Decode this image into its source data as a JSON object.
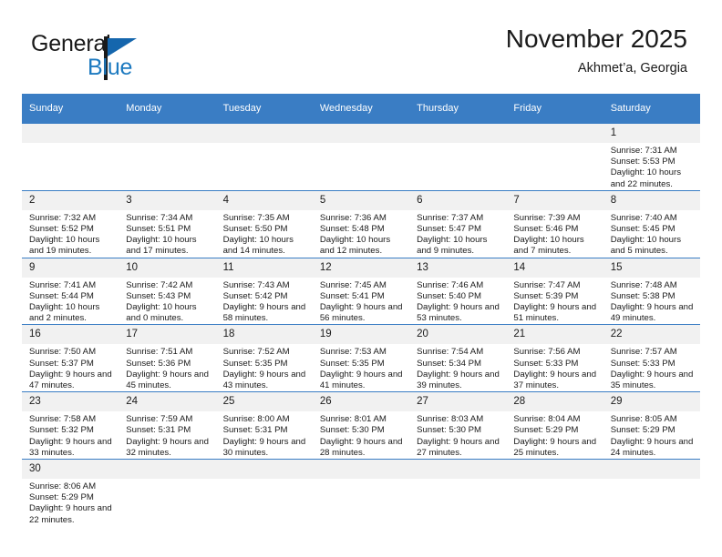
{
  "brand": {
    "name_part1": "General",
    "name_part2": "Blue",
    "logo_icon": "flag-triangle-icon"
  },
  "header": {
    "title": "November 2025",
    "subtitle": "Akhmet’a, Georgia"
  },
  "colors": {
    "header_blue": "#3a7dc4",
    "logo_blue": "#1d7ac0",
    "daynum_background": "#f1f1f1",
    "text": "#1a1a1a"
  },
  "weekday_headers": [
    "Sunday",
    "Monday",
    "Tuesday",
    "Wednesday",
    "Thursday",
    "Friday",
    "Saturday"
  ],
  "labels": {
    "sunrise": "Sunrise:",
    "sunset": "Sunset:",
    "daylight": "Daylight:"
  },
  "weeks": [
    [
      {
        "blank": true
      },
      {
        "blank": true
      },
      {
        "blank": true
      },
      {
        "blank": true
      },
      {
        "blank": true
      },
      {
        "blank": true
      },
      {
        "day": "1",
        "sunrise": "Sunrise: 7:31 AM",
        "sunset": "Sunset: 5:53 PM",
        "daylight": "Daylight: 10 hours and 22 minutes."
      }
    ],
    [
      {
        "day": "2",
        "sunrise": "Sunrise: 7:32 AM",
        "sunset": "Sunset: 5:52 PM",
        "daylight": "Daylight: 10 hours and 19 minutes."
      },
      {
        "day": "3",
        "sunrise": "Sunrise: 7:34 AM",
        "sunset": "Sunset: 5:51 PM",
        "daylight": "Daylight: 10 hours and 17 minutes."
      },
      {
        "day": "4",
        "sunrise": "Sunrise: 7:35 AM",
        "sunset": "Sunset: 5:50 PM",
        "daylight": "Daylight: 10 hours and 14 minutes."
      },
      {
        "day": "5",
        "sunrise": "Sunrise: 7:36 AM",
        "sunset": "Sunset: 5:48 PM",
        "daylight": "Daylight: 10 hours and 12 minutes."
      },
      {
        "day": "6",
        "sunrise": "Sunrise: 7:37 AM",
        "sunset": "Sunset: 5:47 PM",
        "daylight": "Daylight: 10 hours and 9 minutes."
      },
      {
        "day": "7",
        "sunrise": "Sunrise: 7:39 AM",
        "sunset": "Sunset: 5:46 PM",
        "daylight": "Daylight: 10 hours and 7 minutes."
      },
      {
        "day": "8",
        "sunrise": "Sunrise: 7:40 AM",
        "sunset": "Sunset: 5:45 PM",
        "daylight": "Daylight: 10 hours and 5 minutes."
      }
    ],
    [
      {
        "day": "9",
        "sunrise": "Sunrise: 7:41 AM",
        "sunset": "Sunset: 5:44 PM",
        "daylight": "Daylight: 10 hours and 2 minutes."
      },
      {
        "day": "10",
        "sunrise": "Sunrise: 7:42 AM",
        "sunset": "Sunset: 5:43 PM",
        "daylight": "Daylight: 10 hours and 0 minutes."
      },
      {
        "day": "11",
        "sunrise": "Sunrise: 7:43 AM",
        "sunset": "Sunset: 5:42 PM",
        "daylight": "Daylight: 9 hours and 58 minutes."
      },
      {
        "day": "12",
        "sunrise": "Sunrise: 7:45 AM",
        "sunset": "Sunset: 5:41 PM",
        "daylight": "Daylight: 9 hours and 56 minutes."
      },
      {
        "day": "13",
        "sunrise": "Sunrise: 7:46 AM",
        "sunset": "Sunset: 5:40 PM",
        "daylight": "Daylight: 9 hours and 53 minutes."
      },
      {
        "day": "14",
        "sunrise": "Sunrise: 7:47 AM",
        "sunset": "Sunset: 5:39 PM",
        "daylight": "Daylight: 9 hours and 51 minutes."
      },
      {
        "day": "15",
        "sunrise": "Sunrise: 7:48 AM",
        "sunset": "Sunset: 5:38 PM",
        "daylight": "Daylight: 9 hours and 49 minutes."
      }
    ],
    [
      {
        "day": "16",
        "sunrise": "Sunrise: 7:50 AM",
        "sunset": "Sunset: 5:37 PM",
        "daylight": "Daylight: 9 hours and 47 minutes."
      },
      {
        "day": "17",
        "sunrise": "Sunrise: 7:51 AM",
        "sunset": "Sunset: 5:36 PM",
        "daylight": "Daylight: 9 hours and 45 minutes."
      },
      {
        "day": "18",
        "sunrise": "Sunrise: 7:52 AM",
        "sunset": "Sunset: 5:35 PM",
        "daylight": "Daylight: 9 hours and 43 minutes."
      },
      {
        "day": "19",
        "sunrise": "Sunrise: 7:53 AM",
        "sunset": "Sunset: 5:35 PM",
        "daylight": "Daylight: 9 hours and 41 minutes."
      },
      {
        "day": "20",
        "sunrise": "Sunrise: 7:54 AM",
        "sunset": "Sunset: 5:34 PM",
        "daylight": "Daylight: 9 hours and 39 minutes."
      },
      {
        "day": "21",
        "sunrise": "Sunrise: 7:56 AM",
        "sunset": "Sunset: 5:33 PM",
        "daylight": "Daylight: 9 hours and 37 minutes."
      },
      {
        "day": "22",
        "sunrise": "Sunrise: 7:57 AM",
        "sunset": "Sunset: 5:33 PM",
        "daylight": "Daylight: 9 hours and 35 minutes."
      }
    ],
    [
      {
        "day": "23",
        "sunrise": "Sunrise: 7:58 AM",
        "sunset": "Sunset: 5:32 PM",
        "daylight": "Daylight: 9 hours and 33 minutes."
      },
      {
        "day": "24",
        "sunrise": "Sunrise: 7:59 AM",
        "sunset": "Sunset: 5:31 PM",
        "daylight": "Daylight: 9 hours and 32 minutes."
      },
      {
        "day": "25",
        "sunrise": "Sunrise: 8:00 AM",
        "sunset": "Sunset: 5:31 PM",
        "daylight": "Daylight: 9 hours and 30 minutes."
      },
      {
        "day": "26",
        "sunrise": "Sunrise: 8:01 AM",
        "sunset": "Sunset: 5:30 PM",
        "daylight": "Daylight: 9 hours and 28 minutes."
      },
      {
        "day": "27",
        "sunrise": "Sunrise: 8:03 AM",
        "sunset": "Sunset: 5:30 PM",
        "daylight": "Daylight: 9 hours and 27 minutes."
      },
      {
        "day": "28",
        "sunrise": "Sunrise: 8:04 AM",
        "sunset": "Sunset: 5:29 PM",
        "daylight": "Daylight: 9 hours and 25 minutes."
      },
      {
        "day": "29",
        "sunrise": "Sunrise: 8:05 AM",
        "sunset": "Sunset: 5:29 PM",
        "daylight": "Daylight: 9 hours and 24 minutes."
      }
    ],
    [
      {
        "day": "30",
        "sunrise": "Sunrise: 8:06 AM",
        "sunset": "Sunset: 5:29 PM",
        "daylight": "Daylight: 9 hours and 22 minutes."
      },
      {
        "blank": true
      },
      {
        "blank": true
      },
      {
        "blank": true
      },
      {
        "blank": true
      },
      {
        "blank": true
      },
      {
        "blank": true
      }
    ]
  ]
}
